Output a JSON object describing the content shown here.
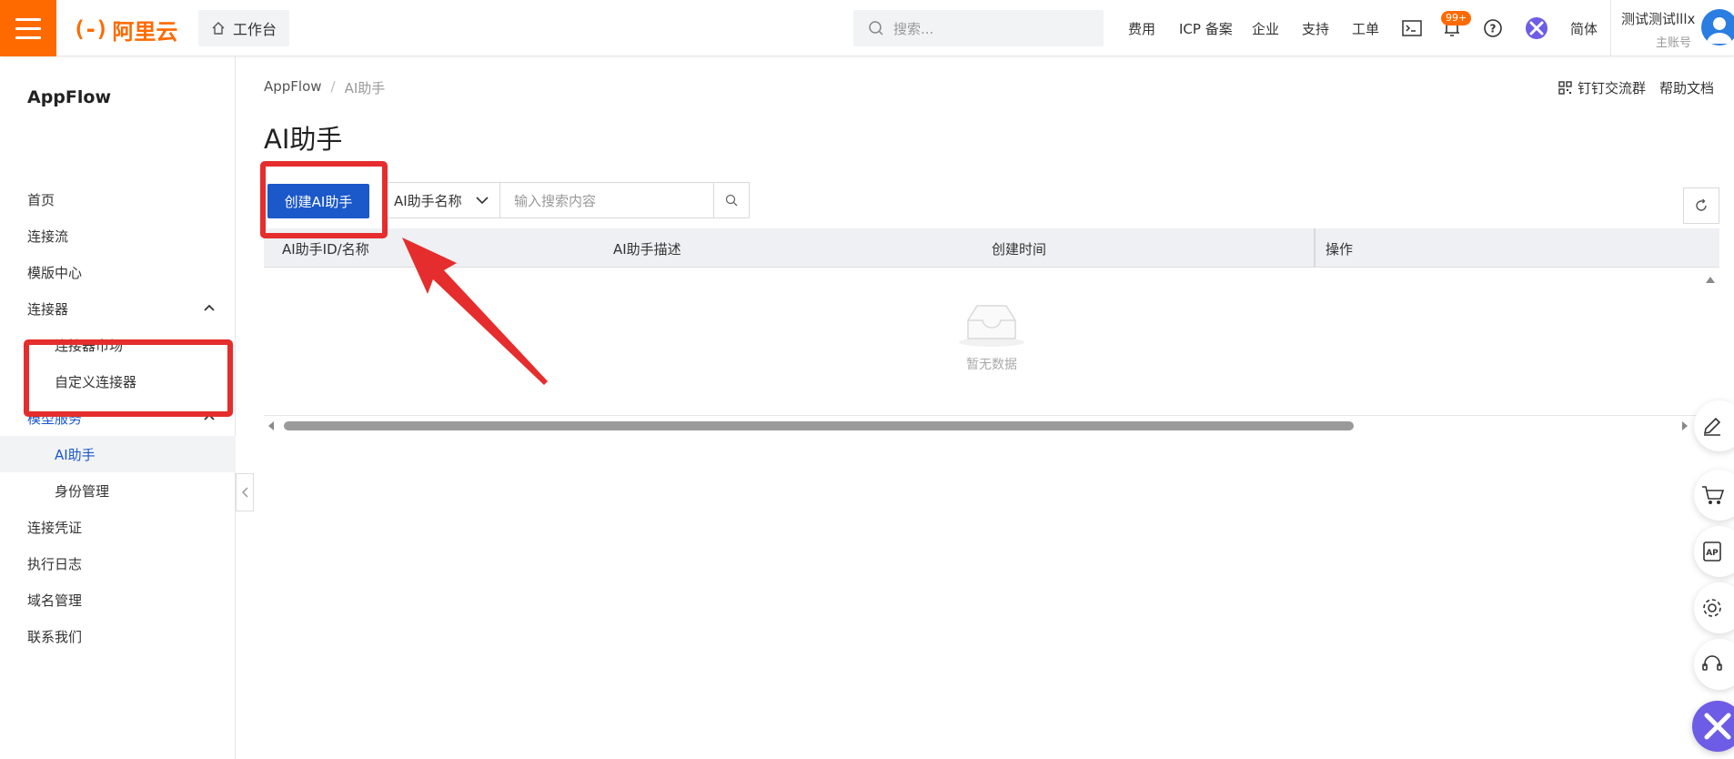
{
  "topbar": {
    "logo_mark": "(-)",
    "logo_text": "阿里云",
    "workbench": "工作台",
    "search_placeholder": "搜索...",
    "nav": [
      "费用",
      "ICP 备案",
      "企业",
      "支持",
      "工单"
    ],
    "badge": "99+",
    "lang": "简体",
    "user_name": "测试测试lllx",
    "user_sub": "主账号"
  },
  "sidebar": {
    "title": "AppFlow",
    "items": [
      {
        "label": "首页"
      },
      {
        "label": "连接流"
      },
      {
        "label": "模版中心"
      },
      {
        "label": "连接器"
      },
      {
        "label": "连接器市场"
      },
      {
        "label": "自定义连接器"
      },
      {
        "label": "模型服务"
      },
      {
        "label": "AI助手"
      },
      {
        "label": "身份管理"
      },
      {
        "label": "连接凭证"
      },
      {
        "label": "执行日志"
      },
      {
        "label": "域名管理"
      },
      {
        "label": "联系我们"
      }
    ]
  },
  "breadcrumb": {
    "root": "AppFlow",
    "sep": "/",
    "current": "AI助手"
  },
  "top_links": {
    "dingtalk": "钉钉交流群",
    "help": "帮助文档"
  },
  "page_title": "AI助手",
  "toolbar": {
    "create_button": "创建AI助手",
    "select_value": "AI助手名称",
    "search_placeholder": "输入搜索内容"
  },
  "table": {
    "columns": [
      "AI助手ID/名称",
      "AI助手描述",
      "创建时间",
      "操作"
    ],
    "empty_text": "暂无数据"
  },
  "colors": {
    "brand": "#ff6a00",
    "primary": "#1b58c9",
    "annotation": "#e52d2d"
  }
}
